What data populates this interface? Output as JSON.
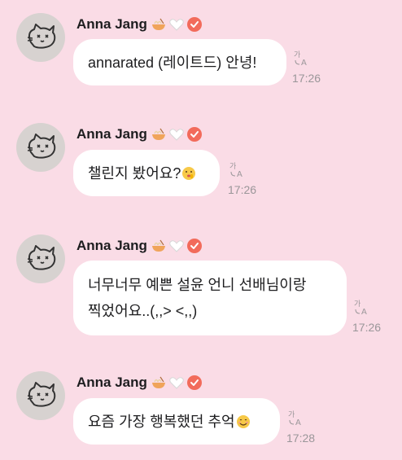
{
  "messages": [
    {
      "sender": "Anna Jang",
      "lines": [
        "annarated (레이트드) 안녕!"
      ],
      "time": "17:26",
      "trailing_emoji": ""
    },
    {
      "sender": "Anna Jang",
      "lines": [
        "챌린지 봤어요?"
      ],
      "time": "17:26",
      "trailing_emoji": "shushing-face"
    },
    {
      "sender": "Anna Jang",
      "lines": [
        "너무너무 예쁜 설윤 언니 선배님이랑",
        "찍었어요..(,,> <,,)"
      ],
      "time": "17:26",
      "trailing_emoji": ""
    },
    {
      "sender": "Anna Jang",
      "lines": [
        "요즘 가장 행복했던 추억"
      ],
      "time": "17:28",
      "trailing_emoji": "smiling-face"
    }
  ],
  "icons": {
    "avatar": "cat-doodle-avatar",
    "name_emojis": [
      "noodle-bowl-emoji",
      "white-heart-emoji",
      "verified-badge-icon"
    ],
    "translate": "translate-icon"
  },
  "colors": {
    "background": "#fadce6",
    "bubble": "#ffffff",
    "verified": "#f26b5b",
    "time": "#9a9699"
  }
}
